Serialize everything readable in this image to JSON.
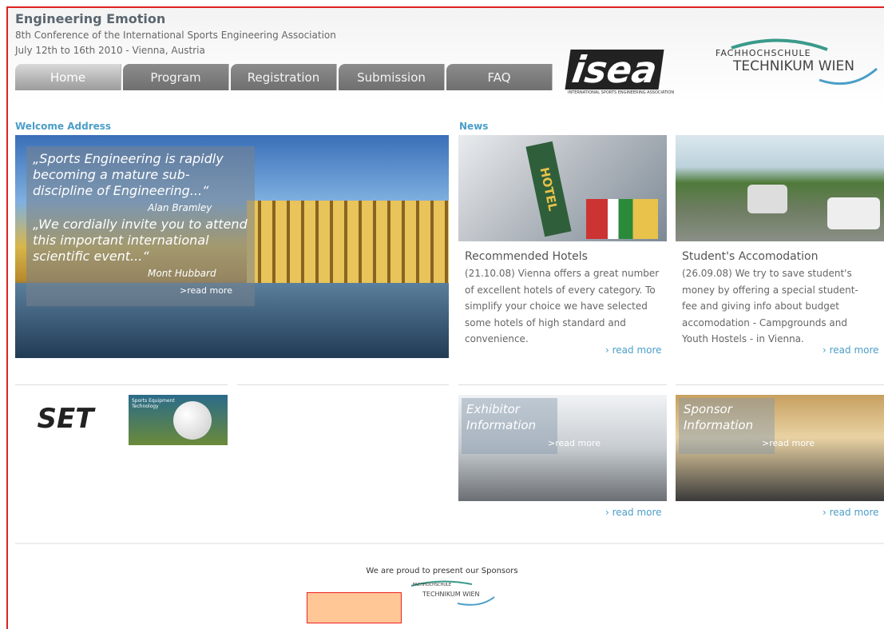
{
  "header": {
    "title": "Engineering Emotion",
    "subtitle": "8th Conference of the International Sports Engineering Association",
    "date": "July 12th to 16th 2010 - Vienna, Austria"
  },
  "tabs": [
    {
      "label": "Home"
    },
    {
      "label": "Program"
    },
    {
      "label": "Registration"
    },
    {
      "label": "Submission"
    },
    {
      "label": "FAQ"
    }
  ],
  "logos": {
    "isea_word": "isea",
    "isea_caption": "INTERNATIONAL SPORTS ENGINEERING ASSOCIATION",
    "fh_top": "FACHHOCHSCHULE",
    "fh_bottom": "TECHNIKUM WIEN"
  },
  "welcome": {
    "heading": "Welcome Address",
    "quote1": "„Sports Engineering is rapidly becoming a mature sub-discipline of Engineering...“",
    "author1": "Alan Bramley",
    "quote2": "„We cordially invite you to attend this important international scientific event...“",
    "author2": "Mont Hubbard",
    "read_more": ">read more"
  },
  "news": {
    "heading": "News",
    "items": [
      {
        "title": "Recommended Hotels",
        "text": "(21.10.08) Vienna offers a great number of excellent hotels of every category. To simplify your choice we have selected some hotels of high standard and convenience.",
        "more": "read more",
        "img_text": "HOTEL"
      },
      {
        "title": "Student's Accomodation",
        "text": "(26.09.08) We try to save student's money by offering a special student-fee and giving info about budget accomodation - Campgrounds and Youth Hostels - in Vienna.",
        "more": "read more"
      }
    ]
  },
  "promos": [
    {
      "title": "Exhibitor Information",
      "overlay_more": ">read more",
      "more": "read more"
    },
    {
      "title": "Sponsor Information",
      "overlay_more": ">read more",
      "more": "read more"
    }
  ],
  "partner_logos": {
    "set": "SET",
    "spt_caption": "Sports Equipment Technology"
  },
  "footer": {
    "sponsors_text": "We are proud to present our Sponsors",
    "fh_top": "FACHHOCHSCHULE",
    "fh_bottom": "TECHNIKUM WIEN"
  },
  "colors": {
    "accent": "#4b9ec8",
    "highlight": "#ffc696",
    "frame": "#dd2222"
  }
}
